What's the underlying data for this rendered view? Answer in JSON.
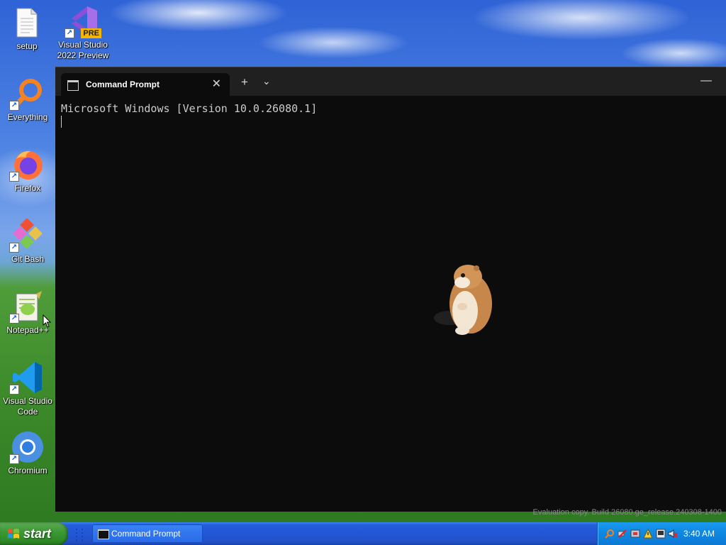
{
  "desktop": {
    "icons": [
      {
        "label": "setup"
      },
      {
        "label": "Visual Studio 2022 Preview",
        "badge": "PRE"
      },
      {
        "label": "Everything"
      },
      {
        "label": "Firefox"
      },
      {
        "label": "Git Bash"
      },
      {
        "label": "Notepad++"
      },
      {
        "label": "Visual Studio Code"
      },
      {
        "label": "Chromium"
      }
    ],
    "watermark": "Evaluation copy. Build 26080.ge_release.240308-1400"
  },
  "terminal": {
    "tab_title": "Command Prompt",
    "tab_close": "✕",
    "new_tab": "+",
    "tab_menu": "⌄",
    "minimize": "—",
    "output": "Microsoft Windows [Version 10.0.26080.1]"
  },
  "taskbar": {
    "start_label": "start",
    "task_label": "Command Prompt",
    "clock": "3:40 AM",
    "tray_icons": [
      "search-icon",
      "network-icon",
      "security-icon",
      "display-icon",
      "volume-icon"
    ]
  },
  "colors": {
    "terminal_bg": "#0c0c0c",
    "tabbar_bg": "#202020",
    "taskbar_blue": "#245edb",
    "start_green": "#3c9a34",
    "tray_blue": "#0f8ae4"
  }
}
